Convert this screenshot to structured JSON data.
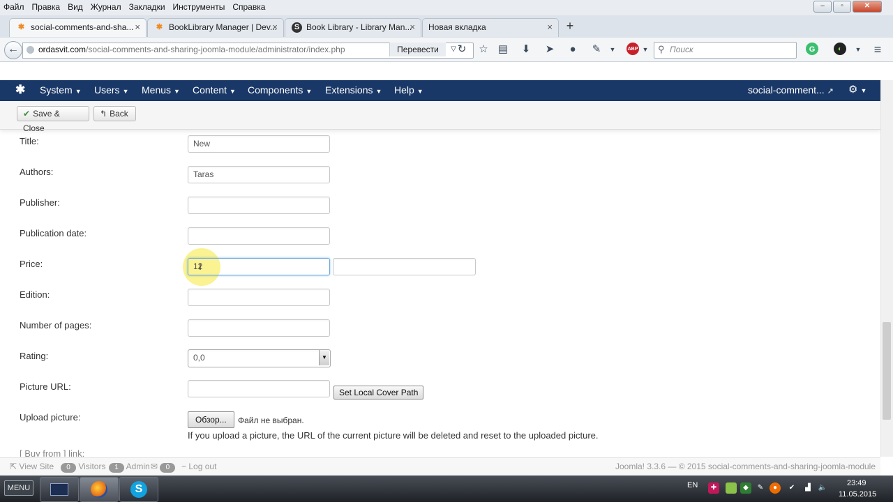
{
  "menubar": {
    "items": [
      "Файл",
      "Правка",
      "Вид",
      "Журнал",
      "Закладки",
      "Инструменты",
      "Справка"
    ]
  },
  "tabs": [
    {
      "label": "social-comments-and-sha...",
      "icon": "joomla-icon",
      "active": true
    },
    {
      "label": "BookLibrary Manager | Dev...",
      "icon": "joomla-icon",
      "active": false
    },
    {
      "label": "Book Library - Library Man...",
      "icon": "s-icon",
      "active": false
    },
    {
      "label": "Новая вкладка",
      "icon": "",
      "active": false
    }
  ],
  "address": {
    "host": "ordasvit.com",
    "path": "/social-comments-and-sharing-joomla-module/administrator/index.php"
  },
  "translate_label": "Перевести",
  "search": {
    "placeholder": "Поиск"
  },
  "joomla_nav": {
    "items": [
      "System",
      "Users",
      "Menus",
      "Content",
      "Components",
      "Extensions",
      "Help"
    ],
    "site_label": "social-comment..."
  },
  "toolbar": {
    "save_close": "Save & Close",
    "back": "Back"
  },
  "form": {
    "title_label": "Title:",
    "title_value": "New",
    "authors_label": "Authors:",
    "authors_value": "Taras",
    "publisher_label": "Publisher:",
    "publication_date_label": "Publication date:",
    "price_label": "Price:",
    "price_value": "12",
    "edition_label": "Edition:",
    "pages_label": "Number of pages:",
    "rating_label": "Rating:",
    "rating_value": "0,0",
    "picture_url_label": "Picture URL:",
    "set_local_cover": "Set Local Cover Path",
    "upload_label": "Upload picture:",
    "browse_button": "Обзор...",
    "no_file": "Файл не выбран.",
    "upload_note": "If you upload a picture, the URL of the current picture will be deleted and reset to the uploaded picture.",
    "buy_from_label": "[ Buy from ] link:"
  },
  "statusbar": {
    "view_site": "View Site",
    "visitors_count": "0",
    "visitors": "Visitors",
    "admin_count": "1",
    "admin": "Admin",
    "messages_count": "0",
    "logout": "Log out",
    "footer": "Joomla! 3.3.6 — © 2015 social-comments-and-sharing-joomla-module"
  },
  "taskbar": {
    "start": "MENU",
    "lang": "EN",
    "time": "23:49",
    "date": "11.05.2015"
  },
  "colors": {
    "joomla_nav_bg": "#1a3867",
    "focus_border": "#6ea6d8",
    "highlight": "#faee6e"
  }
}
